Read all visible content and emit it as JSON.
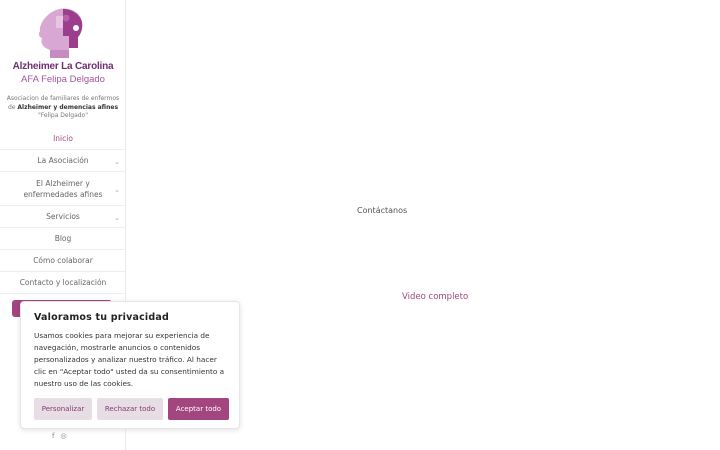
{
  "brand": {
    "line1": "Alzheimer La Carolina",
    "line2": "AFA Felipa Delgado",
    "tagline_a": "Asociacion de familiares de enfermos de ",
    "tagline_b": "Alzheimer y demencias afines",
    "tagline_c": " \"Felipa Delgado\"",
    "logo_icon": "head-puzzle-icon",
    "primary_color": "#a3467f"
  },
  "nav": {
    "items": [
      {
        "label": "Inicio"
      },
      {
        "label": "La Asociación"
      },
      {
        "label": "El Alzheimer y enfermedades afines"
      },
      {
        "label": "Servicios"
      },
      {
        "label": "Blog"
      },
      {
        "label": "Cómo colaborar"
      },
      {
        "label": "Contacto y localización"
      }
    ]
  },
  "main": {
    "contact_link": "Contáctanos",
    "video_link": "Video completo"
  },
  "cookie": {
    "title": "Valoramos tu privacidad",
    "text": "Usamos cookies para mejorar su experiencia de navegación, mostrarle anuncios o contenidos personalizados y analizar nuestro tráfico. Al hacer clic en \"Aceptar todo\" usted da su consentimiento a nuestro uso de las cookies.",
    "customize": "Personalizar",
    "reject": "Rechazar todo",
    "accept": "Aceptar todo"
  },
  "social": {
    "facebook": "f",
    "instagram": "◎"
  }
}
